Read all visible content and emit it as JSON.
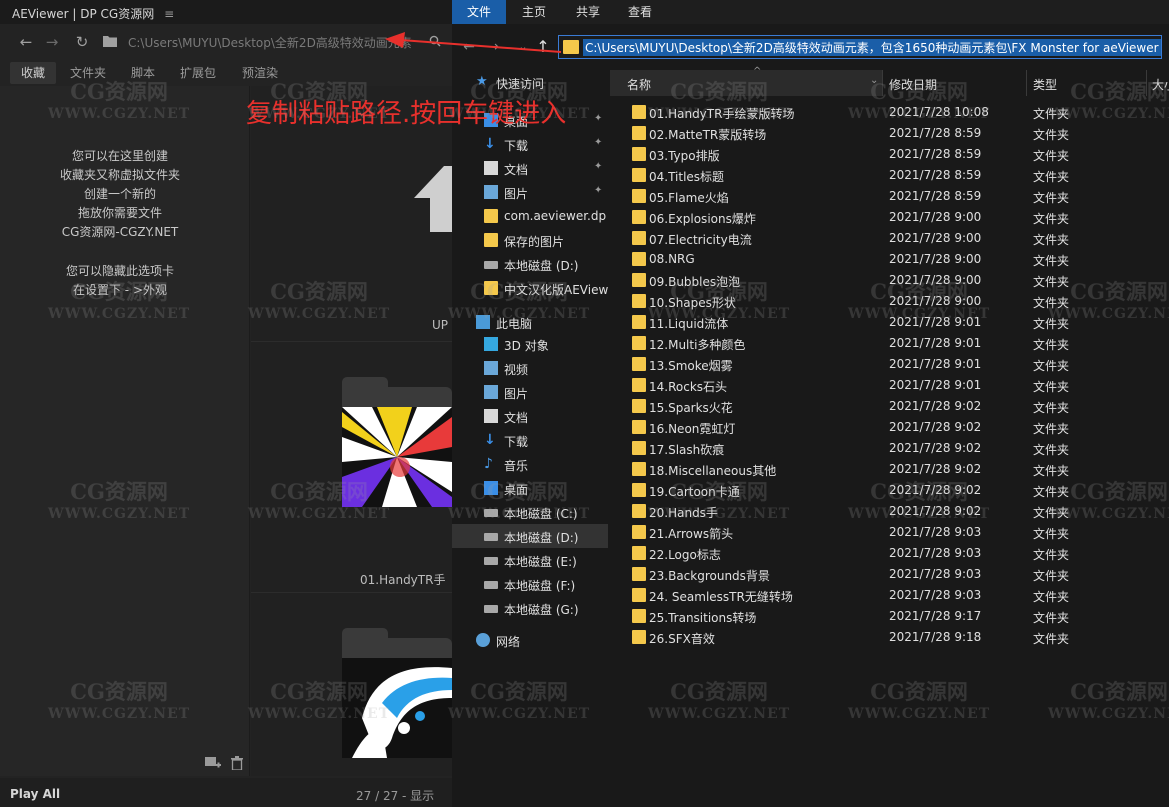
{
  "aeviewer": {
    "title": "AEViewer | DP CG资源网",
    "menu_icon": "≡",
    "path": "C:\\Users\\MUYU\\Desktop\\全新2D高级特效动画元素",
    "tabs": [
      "收藏",
      "文件夹",
      "脚本",
      "扩展包",
      "预渲染"
    ],
    "active_tab": "收藏",
    "note_lines_1": [
      "您可以在这里创建",
      "收藏夹又称虚拟文件夹",
      "创建一个新的",
      "拖放你需要文件",
      "CG资源网-CGZY.NET"
    ],
    "note_lines_2": [
      "您可以隐藏此选项卡",
      "在设置下 - >外观"
    ],
    "up_label": "UP",
    "card_label": "01.HandyTR手",
    "play_all": "Play All",
    "count": "27 / 27 - 显示"
  },
  "annotation": {
    "text": "复制粘贴路径.按回车键进入",
    "color": "#e8302c"
  },
  "explorer": {
    "ribbon_tabs": [
      "文件",
      "主页",
      "共享",
      "查看"
    ],
    "address": "C:\\Users\\MUYU\\Desktop\\全新2D高级特效动画元素，包含1650种动画元素包\\FX Monster for aeViewer",
    "columns": {
      "name": "名称",
      "date": "修改日期",
      "type": "类型",
      "size": "大小"
    },
    "nav": [
      {
        "label": "快速访问",
        "icon": "star-icon",
        "indent": 0
      },
      {
        "label": "桌面",
        "icon": "desktop-icon",
        "indent": 1,
        "pin": true
      },
      {
        "label": "下载",
        "icon": "download-icon",
        "indent": 1,
        "pin": true
      },
      {
        "label": "文档",
        "icon": "document-icon",
        "indent": 1,
        "pin": true
      },
      {
        "label": "图片",
        "icon": "picture-icon",
        "indent": 1,
        "pin": true
      },
      {
        "label": "com.aeviewer.dp",
        "icon": "folder-icon",
        "indent": 1
      },
      {
        "label": "保存的图片",
        "icon": "folder-icon",
        "indent": 1
      },
      {
        "label": "本地磁盘 (D:)",
        "icon": "drive-icon",
        "indent": 1
      },
      {
        "label": "中文汉化版AEView",
        "icon": "folder-icon",
        "indent": 1
      },
      {
        "label": "此电脑",
        "icon": "pc-icon",
        "indent": 0
      },
      {
        "label": "3D 对象",
        "icon": "cube-icon",
        "indent": 1
      },
      {
        "label": "视频",
        "icon": "video-icon",
        "indent": 1
      },
      {
        "label": "图片",
        "icon": "picture-icon",
        "indent": 1
      },
      {
        "label": "文档",
        "icon": "document-icon",
        "indent": 1
      },
      {
        "label": "下载",
        "icon": "download-icon",
        "indent": 1
      },
      {
        "label": "音乐",
        "icon": "music-icon",
        "indent": 1
      },
      {
        "label": "桌面",
        "icon": "desktop-icon",
        "indent": 1
      },
      {
        "label": "本地磁盘 (C:)",
        "icon": "drive-icon",
        "indent": 1
      },
      {
        "label": "本地磁盘 (D:)",
        "icon": "drive-icon",
        "indent": 1,
        "selected": true
      },
      {
        "label": "本地磁盘 (E:)",
        "icon": "drive-icon",
        "indent": 1
      },
      {
        "label": "本地磁盘 (F:)",
        "icon": "drive-icon",
        "indent": 1
      },
      {
        "label": "本地磁盘 (G:)",
        "icon": "drive-icon",
        "indent": 1
      },
      {
        "label": "网络",
        "icon": "network-icon",
        "indent": 0
      }
    ],
    "files": [
      {
        "name": "01.HandyTR手绘蒙版转场",
        "date": "2021/7/28 10:08",
        "type": "文件夹"
      },
      {
        "name": "02.MatteTR蒙版转场",
        "date": "2021/7/28 8:59",
        "type": "文件夹"
      },
      {
        "name": "03.Typo排版",
        "date": "2021/7/28 8:59",
        "type": "文件夹"
      },
      {
        "name": "04.Titles标题",
        "date": "2021/7/28 8:59",
        "type": "文件夹"
      },
      {
        "name": "05.Flame火焰",
        "date": "2021/7/28 8:59",
        "type": "文件夹"
      },
      {
        "name": "06.Explosions爆炸",
        "date": "2021/7/28 9:00",
        "type": "文件夹"
      },
      {
        "name": "07.Electricity电流",
        "date": "2021/7/28 9:00",
        "type": "文件夹"
      },
      {
        "name": "08.NRG",
        "date": "2021/7/28 9:00",
        "type": "文件夹"
      },
      {
        "name": "09.Bubbles泡泡",
        "date": "2021/7/28 9:00",
        "type": "文件夹"
      },
      {
        "name": "10.Shapes形状",
        "date": "2021/7/28 9:00",
        "type": "文件夹"
      },
      {
        "name": "11.Liquid流体",
        "date": "2021/7/28 9:01",
        "type": "文件夹"
      },
      {
        "name": "12.Multi多种颜色",
        "date": "2021/7/28 9:01",
        "type": "文件夹"
      },
      {
        "name": "13.Smoke烟雾",
        "date": "2021/7/28 9:01",
        "type": "文件夹"
      },
      {
        "name": "14.Rocks石头",
        "date": "2021/7/28 9:01",
        "type": "文件夹"
      },
      {
        "name": "15.Sparks火花",
        "date": "2021/7/28 9:02",
        "type": "文件夹"
      },
      {
        "name": "16.Neon霓虹灯",
        "date": "2021/7/28 9:02",
        "type": "文件夹"
      },
      {
        "name": "17.Slash砍痕",
        "date": "2021/7/28 9:02",
        "type": "文件夹"
      },
      {
        "name": "18.Miscellaneous其他",
        "date": "2021/7/28 9:02",
        "type": "文件夹"
      },
      {
        "name": "19.Cartoon卡通",
        "date": "2021/7/28 9:02",
        "type": "文件夹"
      },
      {
        "name": "20.Hands手",
        "date": "2021/7/28 9:02",
        "type": "文件夹"
      },
      {
        "name": "21.Arrows箭头",
        "date": "2021/7/28 9:03",
        "type": "文件夹"
      },
      {
        "name": "22.Logo标志",
        "date": "2021/7/28 9:03",
        "type": "文件夹"
      },
      {
        "name": "23.Backgrounds背景",
        "date": "2021/7/28 9:03",
        "type": "文件夹"
      },
      {
        "name": "24. SeamlessTR无缝转场",
        "date": "2021/7/28 9:03",
        "type": "文件夹"
      },
      {
        "name": "25.Transitions转场",
        "date": "2021/7/28 9:17",
        "type": "文件夹"
      },
      {
        "name": "26.SFX音效",
        "date": "2021/7/28 9:18",
        "type": "文件夹"
      }
    ]
  },
  "watermark": {
    "line1": "CG资源网",
    "line2": "WWW.CGZY.NET"
  }
}
